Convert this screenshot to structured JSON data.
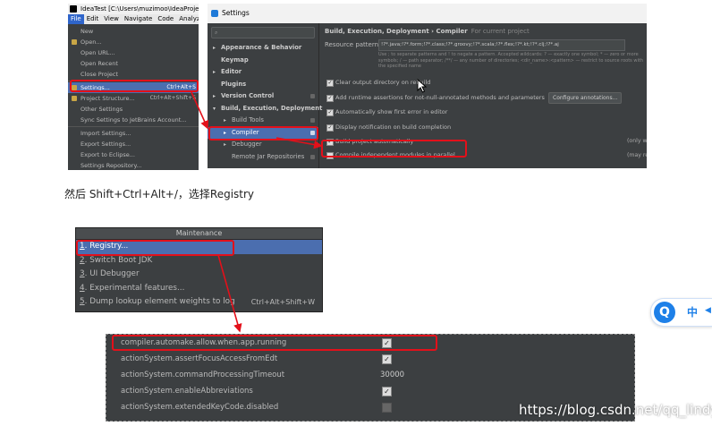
{
  "ide": {
    "title": "IdeaTest [C:\\Users\\muzimoo\\IdeaProjects\\",
    "menubar": [
      "File",
      "Edit",
      "View",
      "Navigate",
      "Code",
      "Analyze"
    ],
    "menu": [
      {
        "label": "New",
        "shortcut": ""
      },
      {
        "label": "Open...",
        "shortcut": ""
      },
      {
        "label": "Open URL...",
        "shortcut": ""
      },
      {
        "label": "Open Recent",
        "shortcut": ""
      },
      {
        "label": "Close Project",
        "shortcut": ""
      },
      {
        "label": "Settings...",
        "shortcut": "Ctrl+Alt+S"
      },
      {
        "label": "Project Structure...",
        "shortcut": "Ctrl+Alt+Shift+S"
      },
      {
        "label": "Other Settings",
        "shortcut": ""
      },
      {
        "label": "Sync Settings to JetBrains Account...",
        "shortcut": ""
      },
      {
        "label": "Import Settings...",
        "shortcut": ""
      },
      {
        "label": "Export Settings...",
        "shortcut": ""
      },
      {
        "label": "Export to Eclipse...",
        "shortcut": ""
      },
      {
        "label": "Settings Repository...",
        "shortcut": ""
      }
    ]
  },
  "settings": {
    "title": "Settings",
    "tree": [
      {
        "label": "Appearance & Behavior"
      },
      {
        "label": "Keymap"
      },
      {
        "label": "Editor"
      },
      {
        "label": "Plugins"
      },
      {
        "label": "Version Control"
      },
      {
        "label": "Build, Execution, Deployment"
      },
      {
        "label": "Build Tools"
      },
      {
        "label": "Compiler"
      },
      {
        "label": "Debugger"
      },
      {
        "label": "Remote Jar Repositories"
      }
    ],
    "breadcrumb": "Build, Execution, Deployment  ›  Compiler",
    "breadcrumb_hint": "For current project",
    "resource_label": "Resource patterns:",
    "resource_value": "!?*.java;!?*.form;!?*.class;!?*.groovy;!?*.scala;!?*.flex;!?*.kt;!?*.clj;!?*.aj",
    "resource_note": "Use ; to separate patterns and ! to negate a pattern. Accepted wildcards: ? — exactly one symbol; * — zero or more symbols; / — path separator; /**/ — any number of directories; <dir_name>:<pattern> — restrict to source roots with the specified name",
    "options": [
      {
        "label": "Clear output directory on rebuild",
        "checked": true,
        "button": "",
        "side": ""
      },
      {
        "label": "Add runtime assertions for not-null-annotated methods and parameters",
        "checked": true,
        "button": "Configure annotations...",
        "side": ""
      },
      {
        "label": "Automatically show first error in editor",
        "checked": true,
        "button": "",
        "side": ""
      },
      {
        "label": "Display notification on build completion",
        "checked": true,
        "button": "",
        "side": ""
      },
      {
        "label": "Build project automatically",
        "checked": true,
        "button": "",
        "side": "(only works while not running / debugging)"
      },
      {
        "label": "Compile independent modules in parallel",
        "checked": false,
        "button": "",
        "side": "(may require larger heap size)"
      }
    ]
  },
  "caption": "然后 Shift+Ctrl+Alt+/，选择Registry",
  "maintenance": {
    "title": "Maintenance",
    "items": [
      {
        "num": "1",
        "label": ". Registry...",
        "shortcut": ""
      },
      {
        "num": "2",
        "label": ". Switch Boot JDK",
        "shortcut": ""
      },
      {
        "num": "3",
        "label": ". UI Debugger",
        "shortcut": ""
      },
      {
        "num": "4",
        "label": ". Experimental features...",
        "shortcut": ""
      },
      {
        "num": "5",
        "label": ". Dump lookup element weights to log",
        "shortcut": "Ctrl+Alt+Shift+W"
      }
    ]
  },
  "registry": [
    {
      "key": "compiler.automake.allow.when.app.running",
      "type": "check",
      "value": true
    },
    {
      "key": "actionSystem.assertFocusAccessFromEdt",
      "type": "check",
      "value": true
    },
    {
      "key": "actionSystem.commandProcessingTimeout",
      "type": "text",
      "value": "30000"
    },
    {
      "key": "actionSystem.enableAbbreviations",
      "type": "check",
      "value": true
    },
    {
      "key": "actionSystem.extendedKeyCode.disabled",
      "type": "check",
      "value": false
    }
  ],
  "ime": {
    "logo": "Q",
    "mode": "中",
    "arrow": "◀"
  },
  "watermark": "https://blog.csdn.net/qq_lindy",
  "colors": {
    "annotation": "#e3101a",
    "selection": "#4b6eaf",
    "ide_bg": "#3c3f41"
  }
}
